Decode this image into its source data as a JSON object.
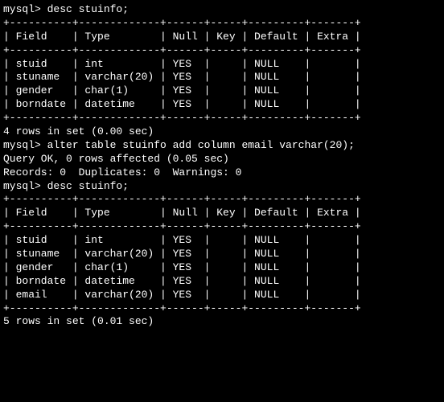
{
  "prompt1": "mysql> desc stuinfo;",
  "border1": "+----------+-------------+------+-----+---------+-------+",
  "header1": "| Field    | Type        | Null | Key | Default | Extra |",
  "table1_rows": [
    "| stuid    | int         | YES  |     | NULL    |       |",
    "| stuname  | varchar(20) | YES  |     | NULL    |       |",
    "| gender   | char(1)     | YES  |     | NULL    |       |",
    "| borndate | datetime    | YES  |     | NULL    |       |"
  ],
  "summary1": "4 rows in set (0.00 sec)",
  "blank": "",
  "prompt2": "mysql> alter table stuinfo add column email varchar(20);",
  "result2a": "Query OK, 0 rows affected (0.05 sec)",
  "result2b": "Records: 0  Duplicates: 0  Warnings: 0",
  "prompt3": "mysql> desc stuinfo;",
  "table2_rows": [
    "| stuid    | int         | YES  |     | NULL    |       |",
    "| stuname  | varchar(20) | YES  |     | NULL    |       |",
    "| gender   | char(1)     | YES  |     | NULL    |       |",
    "| borndate | datetime    | YES  |     | NULL    |       |",
    "| email    | varchar(20) | YES  |     | NULL    |       |"
  ],
  "summary2": "5 rows in set (0.01 sec)"
}
